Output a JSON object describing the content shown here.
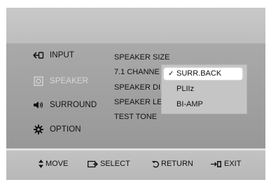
{
  "sidebar": {
    "items": [
      {
        "label": "INPUT",
        "icon": "input-icon",
        "enabled": true
      },
      {
        "label": "SPEAKER",
        "icon": "speaker-settings-icon",
        "enabled": false
      },
      {
        "label": "SURROUND",
        "icon": "surround-speaker-icon",
        "enabled": true
      },
      {
        "label": "OPTION",
        "icon": "gear-icon",
        "enabled": true
      }
    ]
  },
  "menu": {
    "items": [
      {
        "label": "SPEAKER SIZE"
      },
      {
        "label": "7.1 CHANNE"
      },
      {
        "label": "SPEAKER DI"
      },
      {
        "label": "SPEAKER LE"
      },
      {
        "label": "TEST TONE"
      }
    ]
  },
  "dropdown": {
    "options": [
      {
        "label": "SURR.BACK",
        "selected": true,
        "check": "✓"
      },
      {
        "label": "PLIIz",
        "selected": false
      },
      {
        "label": "BI-AMP",
        "selected": false
      }
    ]
  },
  "footer": {
    "hints": [
      {
        "label": "MOVE",
        "icon": "up-down-arrows-icon"
      },
      {
        "label": "SELECT",
        "icon": "enter-icon"
      },
      {
        "label": "RETURN",
        "icon": "return-icon"
      },
      {
        "label": "EXIT",
        "icon": "exit-icon"
      }
    ]
  }
}
